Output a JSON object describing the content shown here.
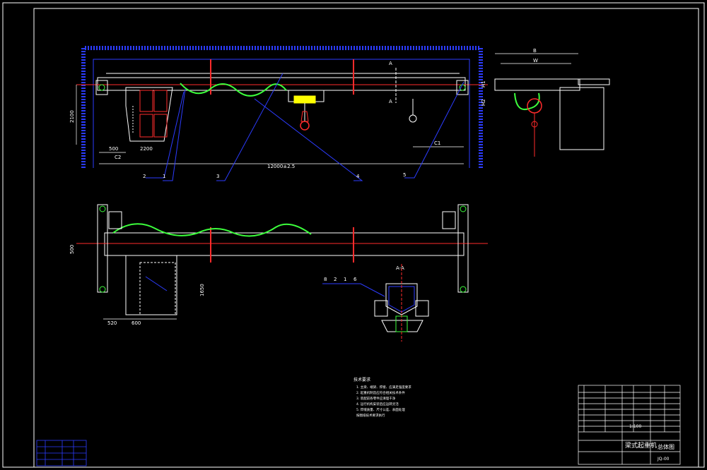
{
  "drawing": {
    "title_cn": "梁式起重机",
    "sheet_name": "总体图",
    "scale": "1:100",
    "sheet_no": "JQ-00"
  },
  "dimensions": {
    "span": "12000±2.5",
    "height": "2100",
    "d500_top": "500",
    "d2200": "2200",
    "d500_side": "500",
    "d1650": "1650",
    "d520": "520",
    "d600": "600",
    "c1": "C1",
    "c2": "C2",
    "b_label": "B",
    "w_label": "W",
    "h1": "H1",
    "h2": "H2",
    "section_a1": "A",
    "section_a2": "A",
    "section_view": "A-A"
  },
  "part_numbers_front": [
    "2",
    "1",
    "3",
    "4",
    "5"
  ],
  "part_numbers_section": [
    "8",
    "2",
    "1",
    "6"
  ],
  "notes": {
    "title": "技术要求",
    "lines": [
      "1. 主梁、端梁、焊接、应满足强度要求",
      "2. 起重机制造应符合相关技术条件",
      "3. 装配前各零件应清理干净",
      "4. 运行机构安装后应运转灵活",
      "5. 焊缝质量、尺寸公差、表面处理",
      "   按图纸技术要求执行"
    ]
  }
}
